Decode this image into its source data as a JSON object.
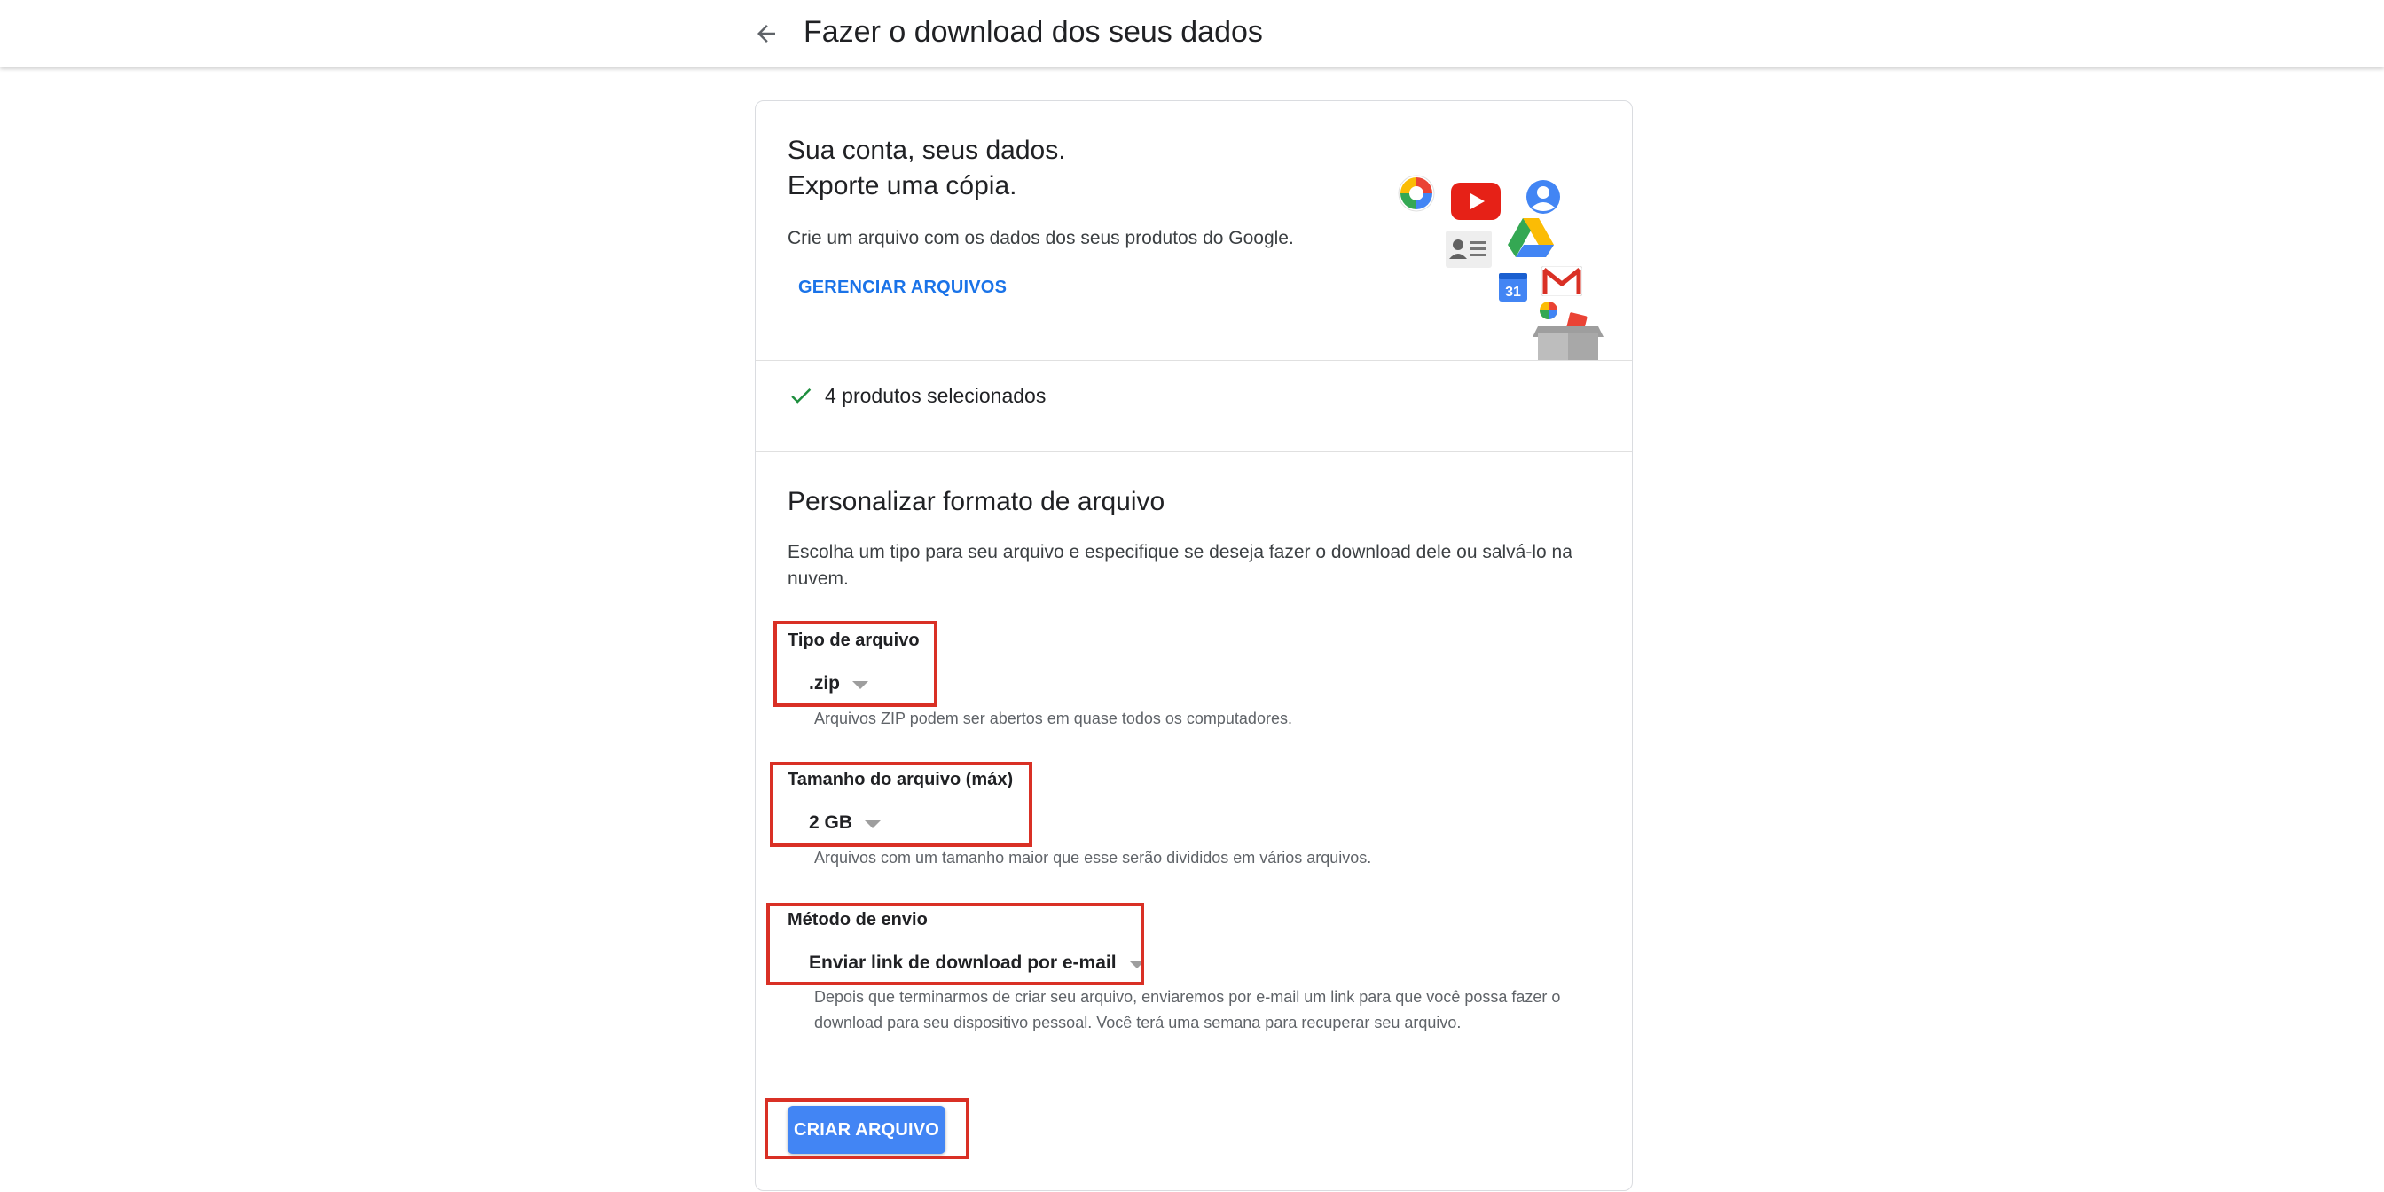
{
  "header": {
    "back_icon": "arrow-back-icon",
    "title": "Fazer o download dos seus dados"
  },
  "intro": {
    "line1": "Sua conta, seus dados.",
    "line2": "Exporte uma cópia.",
    "description": "Crie um arquivo com os dados dos seus produtos do Google.",
    "manage_label": "GERENCIAR ARQUIVOS",
    "calendar_day": "31"
  },
  "selection": {
    "check_icon": "check-icon",
    "label": "4 produtos selecionados"
  },
  "format": {
    "title": "Personalizar formato de arquivo",
    "description": "Escolha um tipo para seu arquivo e especifique se deseja fazer o download dele ou salvá-lo na nuvem.",
    "file_type": {
      "label": "Tipo de arquivo",
      "value": ".zip",
      "helper": "Arquivos ZIP podem ser abertos em quase todos os computadores."
    },
    "file_size": {
      "label": "Tamanho do arquivo (máx)",
      "value": "2 GB",
      "helper": "Arquivos com um tamanho maior que esse serão divididos em vários arquivos."
    },
    "delivery": {
      "label": "Método de envio",
      "value": "Enviar link de download por e-mail",
      "helper": "Depois que terminarmos de criar seu arquivo, enviaremos por e-mail um link para que você possa fazer o download para seu dispositivo pessoal. Você terá uma semana para recuperar seu arquivo."
    },
    "create_label": "CRIAR ARQUIVO"
  },
  "colors": {
    "accent": "#1a73e8",
    "button": "#4285f4",
    "check": "#1e8e3e",
    "highlight": "#d93025"
  }
}
